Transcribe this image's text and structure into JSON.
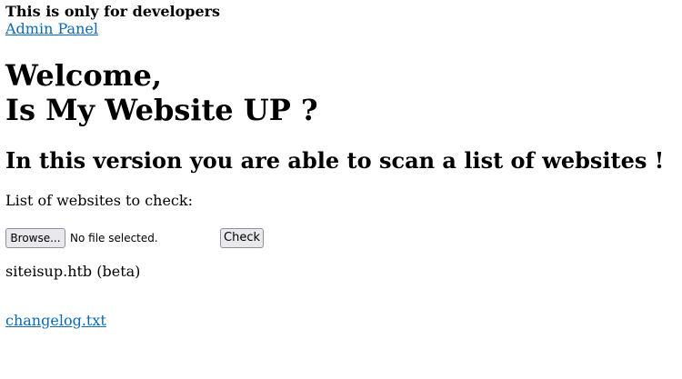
{
  "header": {
    "dev_note": "This is only for developers",
    "admin_link": "Admin Panel"
  },
  "hero": {
    "welcome_line1": "Welcome,",
    "welcome_line2": "Is My Website UP ?",
    "subheading": "In this version you are able to scan a list of websites !"
  },
  "form": {
    "list_label": "List of websites to check:",
    "browse_label": "Browse...",
    "file_status": "No file selected.",
    "check_label": "Check"
  },
  "footer": {
    "site_info": "siteisup.htb (beta)",
    "changelog_link": "changelog.txt"
  },
  "colors": {
    "link": "#0a6ab5",
    "button_bg": "#e9e9ed",
    "button_border": "#8f8f9d"
  }
}
